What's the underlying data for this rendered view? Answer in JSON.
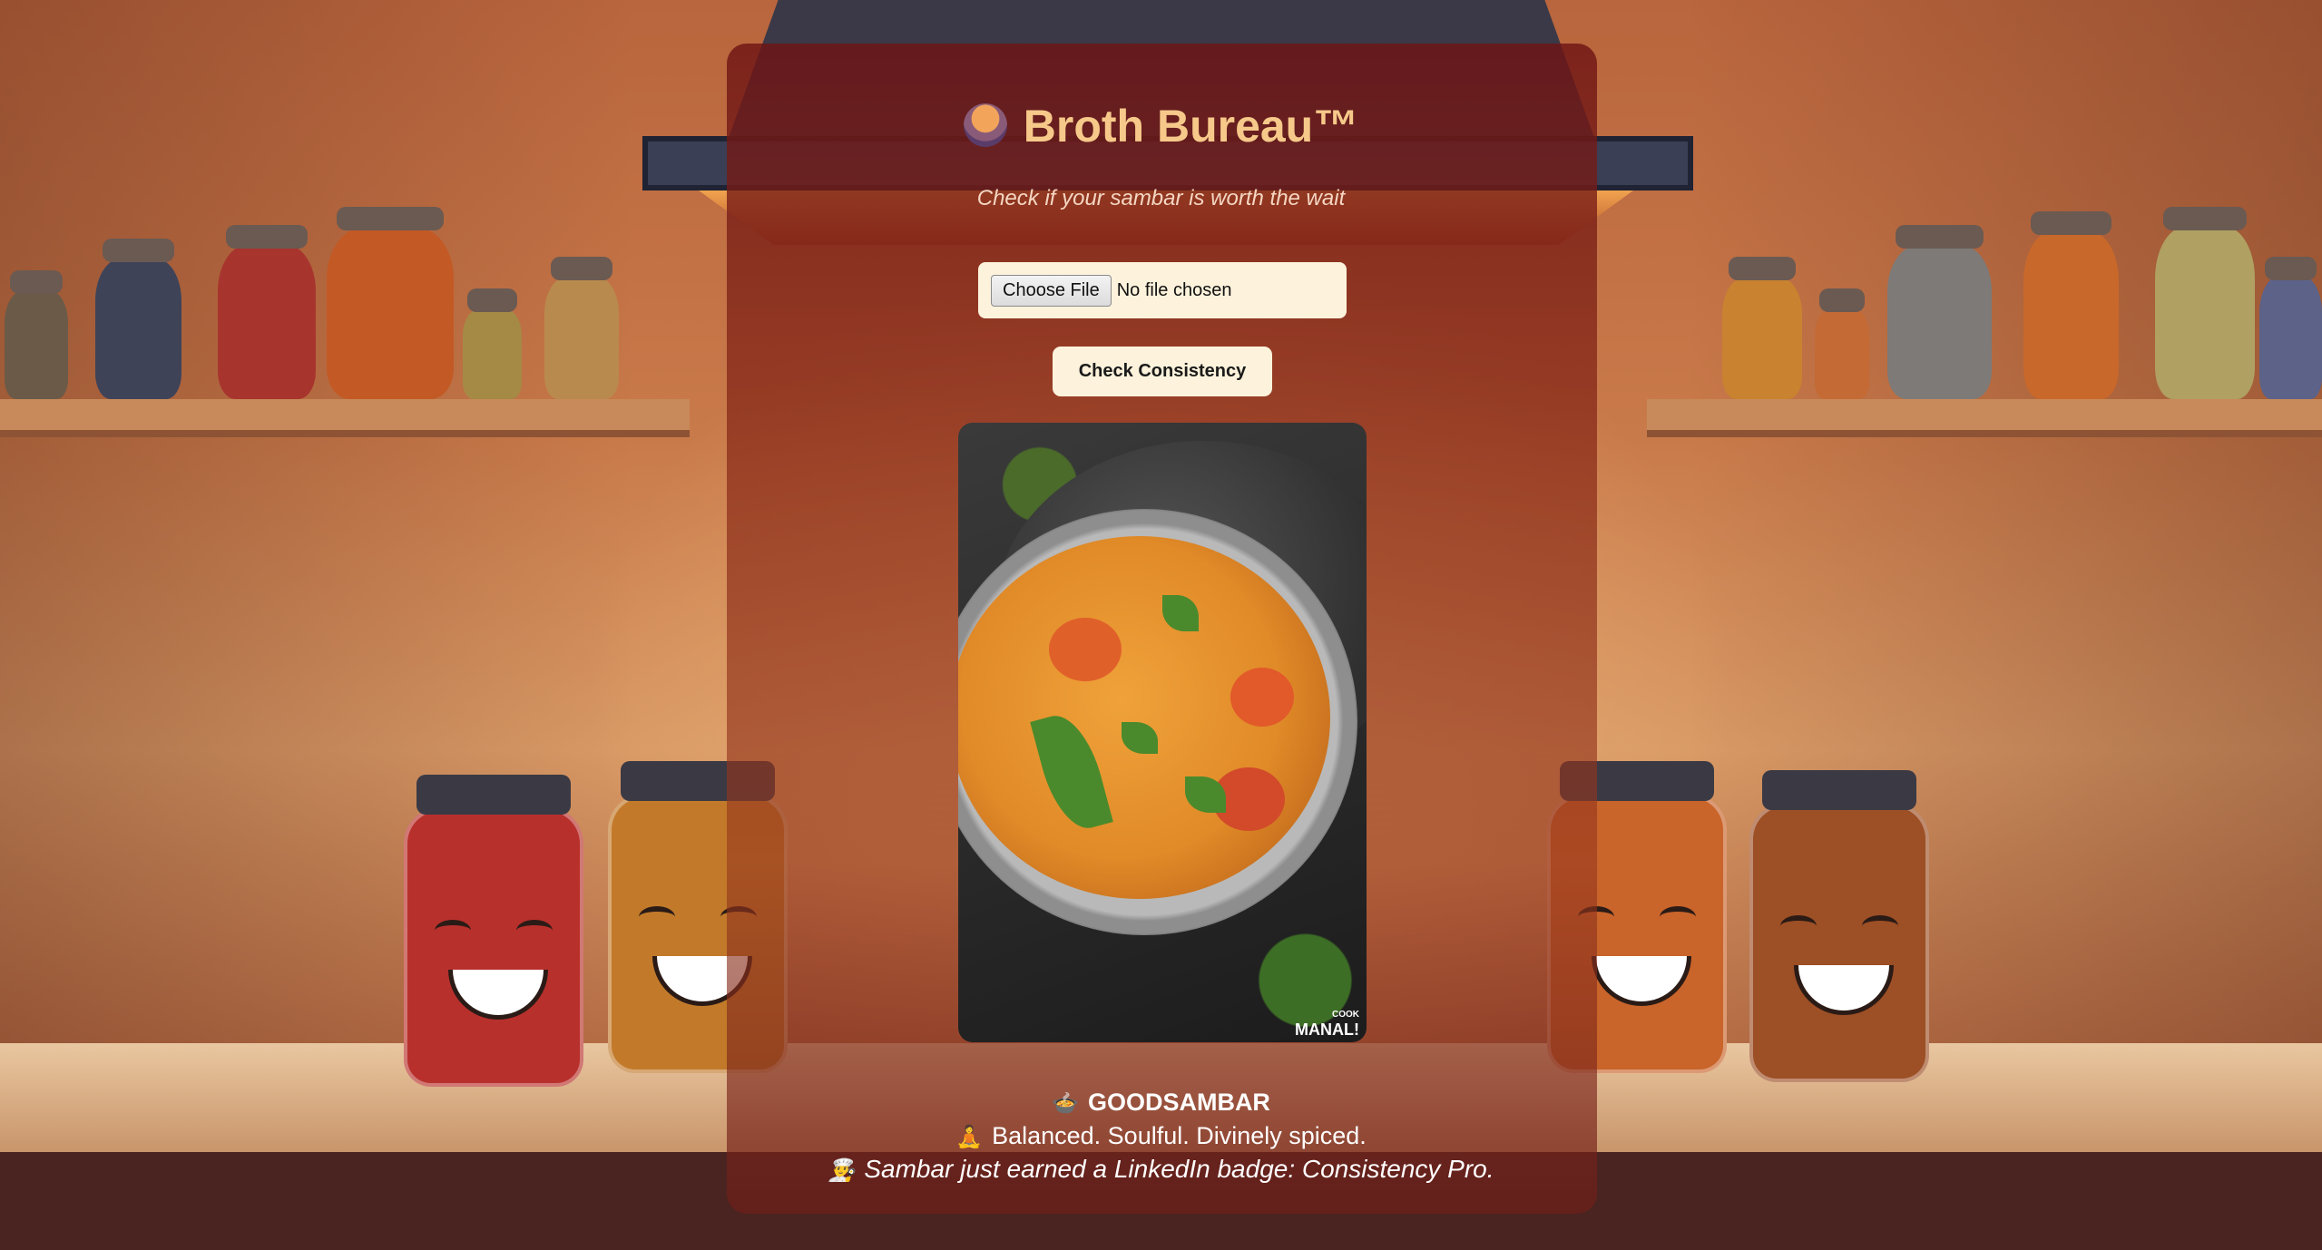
{
  "app": {
    "title": "Broth Bureau™",
    "subtitle": "Check if your sambar is worth the wait",
    "title_icon": "bowl-icon"
  },
  "upload": {
    "button_label": "Choose File",
    "status": "No file chosen"
  },
  "actions": {
    "check_label": "Check Consistency"
  },
  "preview": {
    "watermark_small": "COOK",
    "watermark_large": "MANAL!"
  },
  "result": {
    "verdict_emoji": "🍲",
    "verdict": "GOODSAMBAR",
    "line2_emoji": "🧘",
    "line2": "Balanced. Soulful. Divinely spiced.",
    "line3_emoji": "👨‍🍳",
    "line3": "Sambar just earned a LinkedIn badge: Consistency Pro."
  },
  "colors": {
    "title": "#f6c98a",
    "card": "#6e1414",
    "button_bg": "#fdf3dc"
  }
}
